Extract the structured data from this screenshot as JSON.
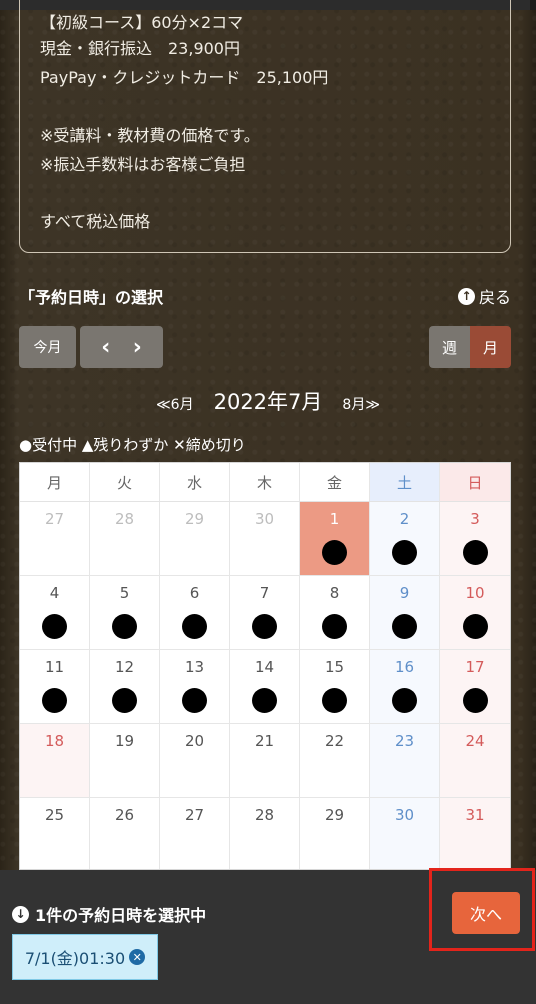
{
  "info": {
    "lines": [
      "【初級コース】60分×2コマ",
      "現金・銀行振込　23,900円",
      "PayPay・クレジットカード　25,100円",
      "※受講料・教材費の価格です。",
      "※振込手数料はお客様ご負担",
      "すべて税込価格"
    ]
  },
  "section": {
    "title": "「予約日時」の選択",
    "back_label": "戻る"
  },
  "controls": {
    "this_month": "今月",
    "prev": "‹",
    "next": "›",
    "week": "週",
    "month": "月"
  },
  "month_switch": {
    "prev_label": "≪6月",
    "current": "2022年7月",
    "next_label": "8月≫"
  },
  "legend": "●受付中 ▲残りわずか ✕締め切り",
  "calendar": {
    "weekdays": [
      "月",
      "火",
      "水",
      "木",
      "金",
      "土",
      "日"
    ],
    "weeks": [
      [
        {
          "d": "27",
          "muted": true,
          "dot": false
        },
        {
          "d": "28",
          "muted": true,
          "dot": false
        },
        {
          "d": "29",
          "muted": true,
          "dot": false
        },
        {
          "d": "30",
          "muted": true,
          "dot": false
        },
        {
          "d": "1",
          "selected": true,
          "dot": true
        },
        {
          "d": "2",
          "dot": true
        },
        {
          "d": "3",
          "dot": true
        }
      ],
      [
        {
          "d": "4",
          "dot": true
        },
        {
          "d": "5",
          "dot": true
        },
        {
          "d": "6",
          "dot": true
        },
        {
          "d": "7",
          "dot": true
        },
        {
          "d": "8",
          "dot": true
        },
        {
          "d": "9",
          "dot": true
        },
        {
          "d": "10",
          "dot": true
        }
      ],
      [
        {
          "d": "11",
          "dot": true
        },
        {
          "d": "12",
          "dot": true
        },
        {
          "d": "13",
          "dot": true
        },
        {
          "d": "14",
          "dot": true
        },
        {
          "d": "15",
          "dot": true
        },
        {
          "d": "16",
          "dot": true
        },
        {
          "d": "17",
          "dot": true
        }
      ],
      [
        {
          "d": "18",
          "holiday": true,
          "dot": false
        },
        {
          "d": "19",
          "dot": false
        },
        {
          "d": "20",
          "dot": false
        },
        {
          "d": "21",
          "dot": false
        },
        {
          "d": "22",
          "dot": false
        },
        {
          "d": "23",
          "dot": false
        },
        {
          "d": "24",
          "dot": false
        }
      ],
      [
        {
          "d": "25",
          "dot": false
        },
        {
          "d": "26",
          "dot": false
        },
        {
          "d": "27",
          "dot": false
        },
        {
          "d": "28",
          "dot": false
        },
        {
          "d": "29",
          "dot": false
        },
        {
          "d": "30",
          "dot": false
        },
        {
          "d": "31",
          "dot": false
        }
      ]
    ]
  },
  "bottom": {
    "selected_text": "1件の予約日時を選択中",
    "chip_label": "7/1(金)01:30",
    "next_button": "次へ"
  },
  "colors": {
    "selected_day": "#ec9a84",
    "next_button": "#e7653c",
    "highlight_box": "#e3241b",
    "chip_bg": "#cfeefa"
  }
}
